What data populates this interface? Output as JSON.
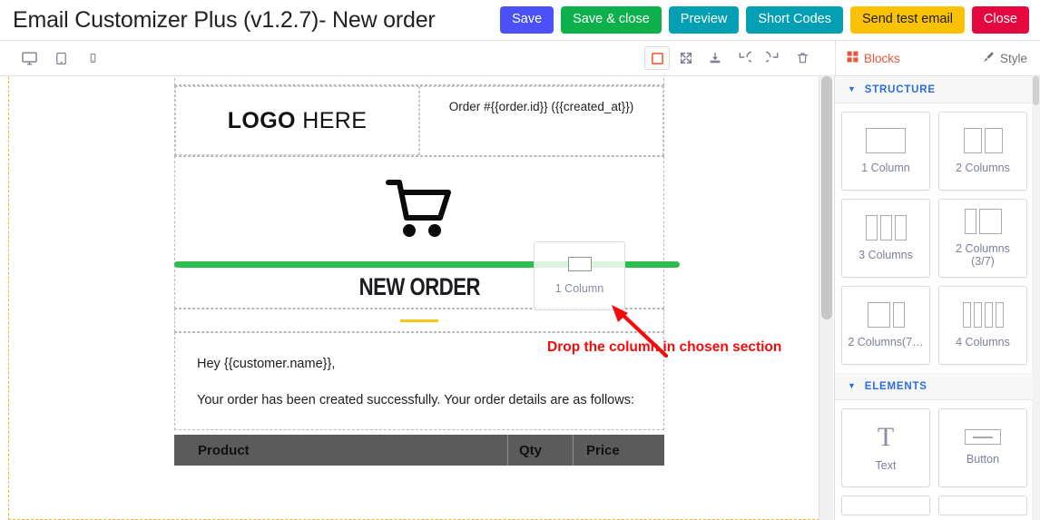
{
  "header": {
    "title": "Email Customizer Plus (v1.2.7)- New order",
    "buttons": [
      {
        "label": "Save",
        "name": "save-button",
        "bg": "#4c51f7",
        "fg": "#ffffff"
      },
      {
        "label": "Save & close",
        "name": "save-and-close-button",
        "bg": "#0cb14b",
        "fg": "#ffffff"
      },
      {
        "label": "Preview",
        "name": "preview-button",
        "bg": "#039fb3",
        "fg": "#ffffff"
      },
      {
        "label": "Short Codes",
        "name": "short-codes-button",
        "bg": "#039fb3",
        "fg": "#ffffff"
      },
      {
        "label": "Send test email",
        "name": "send-test-email-button",
        "bg": "#fbc203",
        "fg": "#1b1b1b"
      },
      {
        "label": "Close",
        "name": "close-button",
        "bg": "#e4083f",
        "fg": "#ffffff"
      }
    ]
  },
  "toolbar": {
    "devices": [
      {
        "name": "desktop-view-icon",
        "title": "Desktop"
      },
      {
        "name": "tablet-view-icon",
        "title": "Tablet"
      },
      {
        "name": "mobile-view-icon",
        "title": "Mobile"
      }
    ],
    "tools": [
      {
        "name": "toggle-borders-icon",
        "title": "Toggle borders",
        "active": true
      },
      {
        "name": "fullscreen-icon",
        "title": "Fullscreen",
        "active": false
      },
      {
        "name": "import-icon",
        "title": "Import",
        "active": false
      },
      {
        "name": "undo-icon",
        "title": "Undo",
        "active": false
      },
      {
        "name": "redo-icon",
        "title": "Redo",
        "active": false
      },
      {
        "name": "trash-icon",
        "title": "Clear canvas",
        "active": false
      }
    ]
  },
  "panel_tabs": {
    "blocks_label": "Blocks",
    "style_label": "Style",
    "active": "Blocks",
    "blocks_color": "#e8563f",
    "style_color": "#707070"
  },
  "blocks_panel": {
    "sections": [
      {
        "title": "STRUCTURE",
        "items": [
          {
            "label": "1 Column",
            "glyph": "col1"
          },
          {
            "label": "2 Columns",
            "glyph": "col2"
          },
          {
            "label": "3 Columns",
            "glyph": "col3"
          },
          {
            "label": "2 Columns (3/7)",
            "glyph": "col37"
          },
          {
            "label": "2 Columns(7…",
            "glyph": "col73"
          },
          {
            "label": "4 Columns",
            "glyph": "col4"
          }
        ]
      },
      {
        "title": "ELEMENTS",
        "items": [
          {
            "label": "Text",
            "glyph": "text"
          },
          {
            "label": "Button",
            "glyph": "button"
          }
        ]
      }
    ]
  },
  "canvas": {
    "logo": {
      "bold": "LOGO",
      "light": " HERE"
    },
    "order_meta": "Order #{{order.id}} ({{created_at}})",
    "cart_icon": "shopping-cart-icon",
    "title_heading": "NEW ORDER",
    "divider_color": "#f5c518",
    "greeting_line1": "Hey {{customer.name}},",
    "greeting_line2": "Your order has been created successfully. Your order details are as follows:",
    "table_headers": {
      "product": "Product",
      "qty": "Qty",
      "price": "Price"
    }
  },
  "drag": {
    "ghost_label": "1 Column",
    "annotation_text": "Drop the column in chosen section",
    "annotation_color": "#f40b0b",
    "drop_indicator_color": "#2dbd4e"
  }
}
